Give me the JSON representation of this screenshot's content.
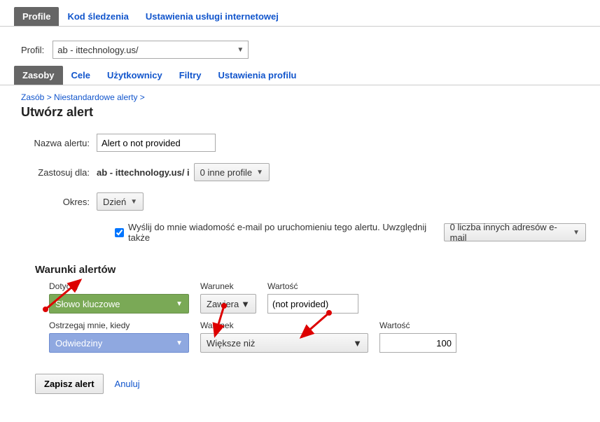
{
  "top_tabs": {
    "profile": "Profile",
    "tracking": "Kod śledzenia",
    "settings": "Ustawienia usługi internetowej"
  },
  "profil": {
    "label": "Profil:",
    "value": "ab - ittechnology.us/"
  },
  "sub_tabs": {
    "zasoby": "Zasoby",
    "cele": "Cele",
    "uzytkownicy": "Użytkownicy",
    "filtry": "Filtry",
    "ustawienia": "Ustawienia profilu"
  },
  "breadcrumb": {
    "zasob": "Zasób",
    "sep1": " > ",
    "alerty": "Niestandardowe alerty",
    "sep2": " >"
  },
  "page_title": "Utwórz alert",
  "form": {
    "nazwa_label": "Nazwa alertu:",
    "nazwa_value": "Alert o not provided",
    "zastosuj_label": "Zastosuj dla:",
    "zastosuj_value": "ab - ittechnology.us/ i",
    "zastosuj_dd": "0 inne profile",
    "okres_label": "Okres:",
    "okres_value": "Dzień",
    "checkbox_text": "Wyślij do mnie wiadomość e-mail po uruchomieniu tego alertu. Uwzględnij także",
    "email_dd": "0 liczba innych adresów e-mail"
  },
  "conditions": {
    "title": "Warunki alertów",
    "row1": {
      "dotyczy_label": "Dotyczy",
      "dotyczy_value": "Słowo kluczowe",
      "warunek_label": "Warunek",
      "warunek_value": "Zawiera",
      "wartosc_label": "Wartość",
      "wartosc_value": "(not provided)"
    },
    "row2": {
      "ostrzegaj_label": "Ostrzegaj mnie, kiedy",
      "ostrzegaj_value": "Odwiedziny",
      "warunek_label": "Warunek",
      "warunek_value": "Większe niż",
      "wartosc_label": "Wartość",
      "wartosc_value": "100"
    }
  },
  "actions": {
    "save": "Zapisz alert",
    "cancel": "Anuluj"
  }
}
